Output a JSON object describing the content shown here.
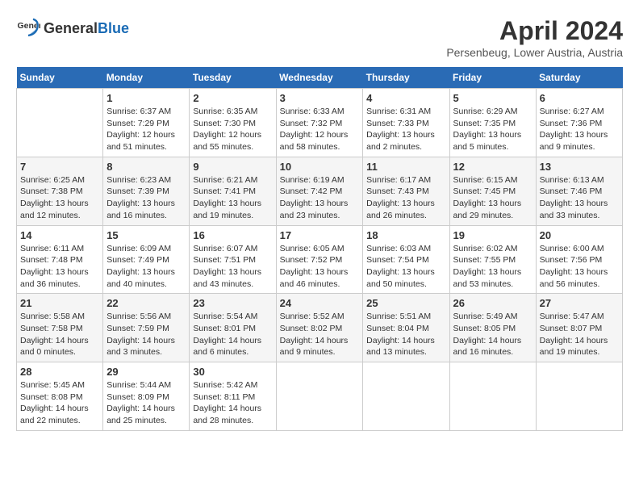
{
  "header": {
    "logo_general": "General",
    "logo_blue": "Blue",
    "main_title": "April 2024",
    "sub_title": "Persenbeug, Lower Austria, Austria"
  },
  "days_of_week": [
    "Sunday",
    "Monday",
    "Tuesday",
    "Wednesday",
    "Thursday",
    "Friday",
    "Saturday"
  ],
  "weeks": [
    [
      {
        "day": "",
        "info": ""
      },
      {
        "day": "1",
        "info": "Sunrise: 6:37 AM\nSunset: 7:29 PM\nDaylight: 12 hours\nand 51 minutes."
      },
      {
        "day": "2",
        "info": "Sunrise: 6:35 AM\nSunset: 7:30 PM\nDaylight: 12 hours\nand 55 minutes."
      },
      {
        "day": "3",
        "info": "Sunrise: 6:33 AM\nSunset: 7:32 PM\nDaylight: 12 hours\nand 58 minutes."
      },
      {
        "day": "4",
        "info": "Sunrise: 6:31 AM\nSunset: 7:33 PM\nDaylight: 13 hours\nand 2 minutes."
      },
      {
        "day": "5",
        "info": "Sunrise: 6:29 AM\nSunset: 7:35 PM\nDaylight: 13 hours\nand 5 minutes."
      },
      {
        "day": "6",
        "info": "Sunrise: 6:27 AM\nSunset: 7:36 PM\nDaylight: 13 hours\nand 9 minutes."
      }
    ],
    [
      {
        "day": "7",
        "info": "Sunrise: 6:25 AM\nSunset: 7:38 PM\nDaylight: 13 hours\nand 12 minutes."
      },
      {
        "day": "8",
        "info": "Sunrise: 6:23 AM\nSunset: 7:39 PM\nDaylight: 13 hours\nand 16 minutes."
      },
      {
        "day": "9",
        "info": "Sunrise: 6:21 AM\nSunset: 7:41 PM\nDaylight: 13 hours\nand 19 minutes."
      },
      {
        "day": "10",
        "info": "Sunrise: 6:19 AM\nSunset: 7:42 PM\nDaylight: 13 hours\nand 23 minutes."
      },
      {
        "day": "11",
        "info": "Sunrise: 6:17 AM\nSunset: 7:43 PM\nDaylight: 13 hours\nand 26 minutes."
      },
      {
        "day": "12",
        "info": "Sunrise: 6:15 AM\nSunset: 7:45 PM\nDaylight: 13 hours\nand 29 minutes."
      },
      {
        "day": "13",
        "info": "Sunrise: 6:13 AM\nSunset: 7:46 PM\nDaylight: 13 hours\nand 33 minutes."
      }
    ],
    [
      {
        "day": "14",
        "info": "Sunrise: 6:11 AM\nSunset: 7:48 PM\nDaylight: 13 hours\nand 36 minutes."
      },
      {
        "day": "15",
        "info": "Sunrise: 6:09 AM\nSunset: 7:49 PM\nDaylight: 13 hours\nand 40 minutes."
      },
      {
        "day": "16",
        "info": "Sunrise: 6:07 AM\nSunset: 7:51 PM\nDaylight: 13 hours\nand 43 minutes."
      },
      {
        "day": "17",
        "info": "Sunrise: 6:05 AM\nSunset: 7:52 PM\nDaylight: 13 hours\nand 46 minutes."
      },
      {
        "day": "18",
        "info": "Sunrise: 6:03 AM\nSunset: 7:54 PM\nDaylight: 13 hours\nand 50 minutes."
      },
      {
        "day": "19",
        "info": "Sunrise: 6:02 AM\nSunset: 7:55 PM\nDaylight: 13 hours\nand 53 minutes."
      },
      {
        "day": "20",
        "info": "Sunrise: 6:00 AM\nSunset: 7:56 PM\nDaylight: 13 hours\nand 56 minutes."
      }
    ],
    [
      {
        "day": "21",
        "info": "Sunrise: 5:58 AM\nSunset: 7:58 PM\nDaylight: 14 hours\nand 0 minutes."
      },
      {
        "day": "22",
        "info": "Sunrise: 5:56 AM\nSunset: 7:59 PM\nDaylight: 14 hours\nand 3 minutes."
      },
      {
        "day": "23",
        "info": "Sunrise: 5:54 AM\nSunset: 8:01 PM\nDaylight: 14 hours\nand 6 minutes."
      },
      {
        "day": "24",
        "info": "Sunrise: 5:52 AM\nSunset: 8:02 PM\nDaylight: 14 hours\nand 9 minutes."
      },
      {
        "day": "25",
        "info": "Sunrise: 5:51 AM\nSunset: 8:04 PM\nDaylight: 14 hours\nand 13 minutes."
      },
      {
        "day": "26",
        "info": "Sunrise: 5:49 AM\nSunset: 8:05 PM\nDaylight: 14 hours\nand 16 minutes."
      },
      {
        "day": "27",
        "info": "Sunrise: 5:47 AM\nSunset: 8:07 PM\nDaylight: 14 hours\nand 19 minutes."
      }
    ],
    [
      {
        "day": "28",
        "info": "Sunrise: 5:45 AM\nSunset: 8:08 PM\nDaylight: 14 hours\nand 22 minutes."
      },
      {
        "day": "29",
        "info": "Sunrise: 5:44 AM\nSunset: 8:09 PM\nDaylight: 14 hours\nand 25 minutes."
      },
      {
        "day": "30",
        "info": "Sunrise: 5:42 AM\nSunset: 8:11 PM\nDaylight: 14 hours\nand 28 minutes."
      },
      {
        "day": "",
        "info": ""
      },
      {
        "day": "",
        "info": ""
      },
      {
        "day": "",
        "info": ""
      },
      {
        "day": "",
        "info": ""
      }
    ]
  ]
}
